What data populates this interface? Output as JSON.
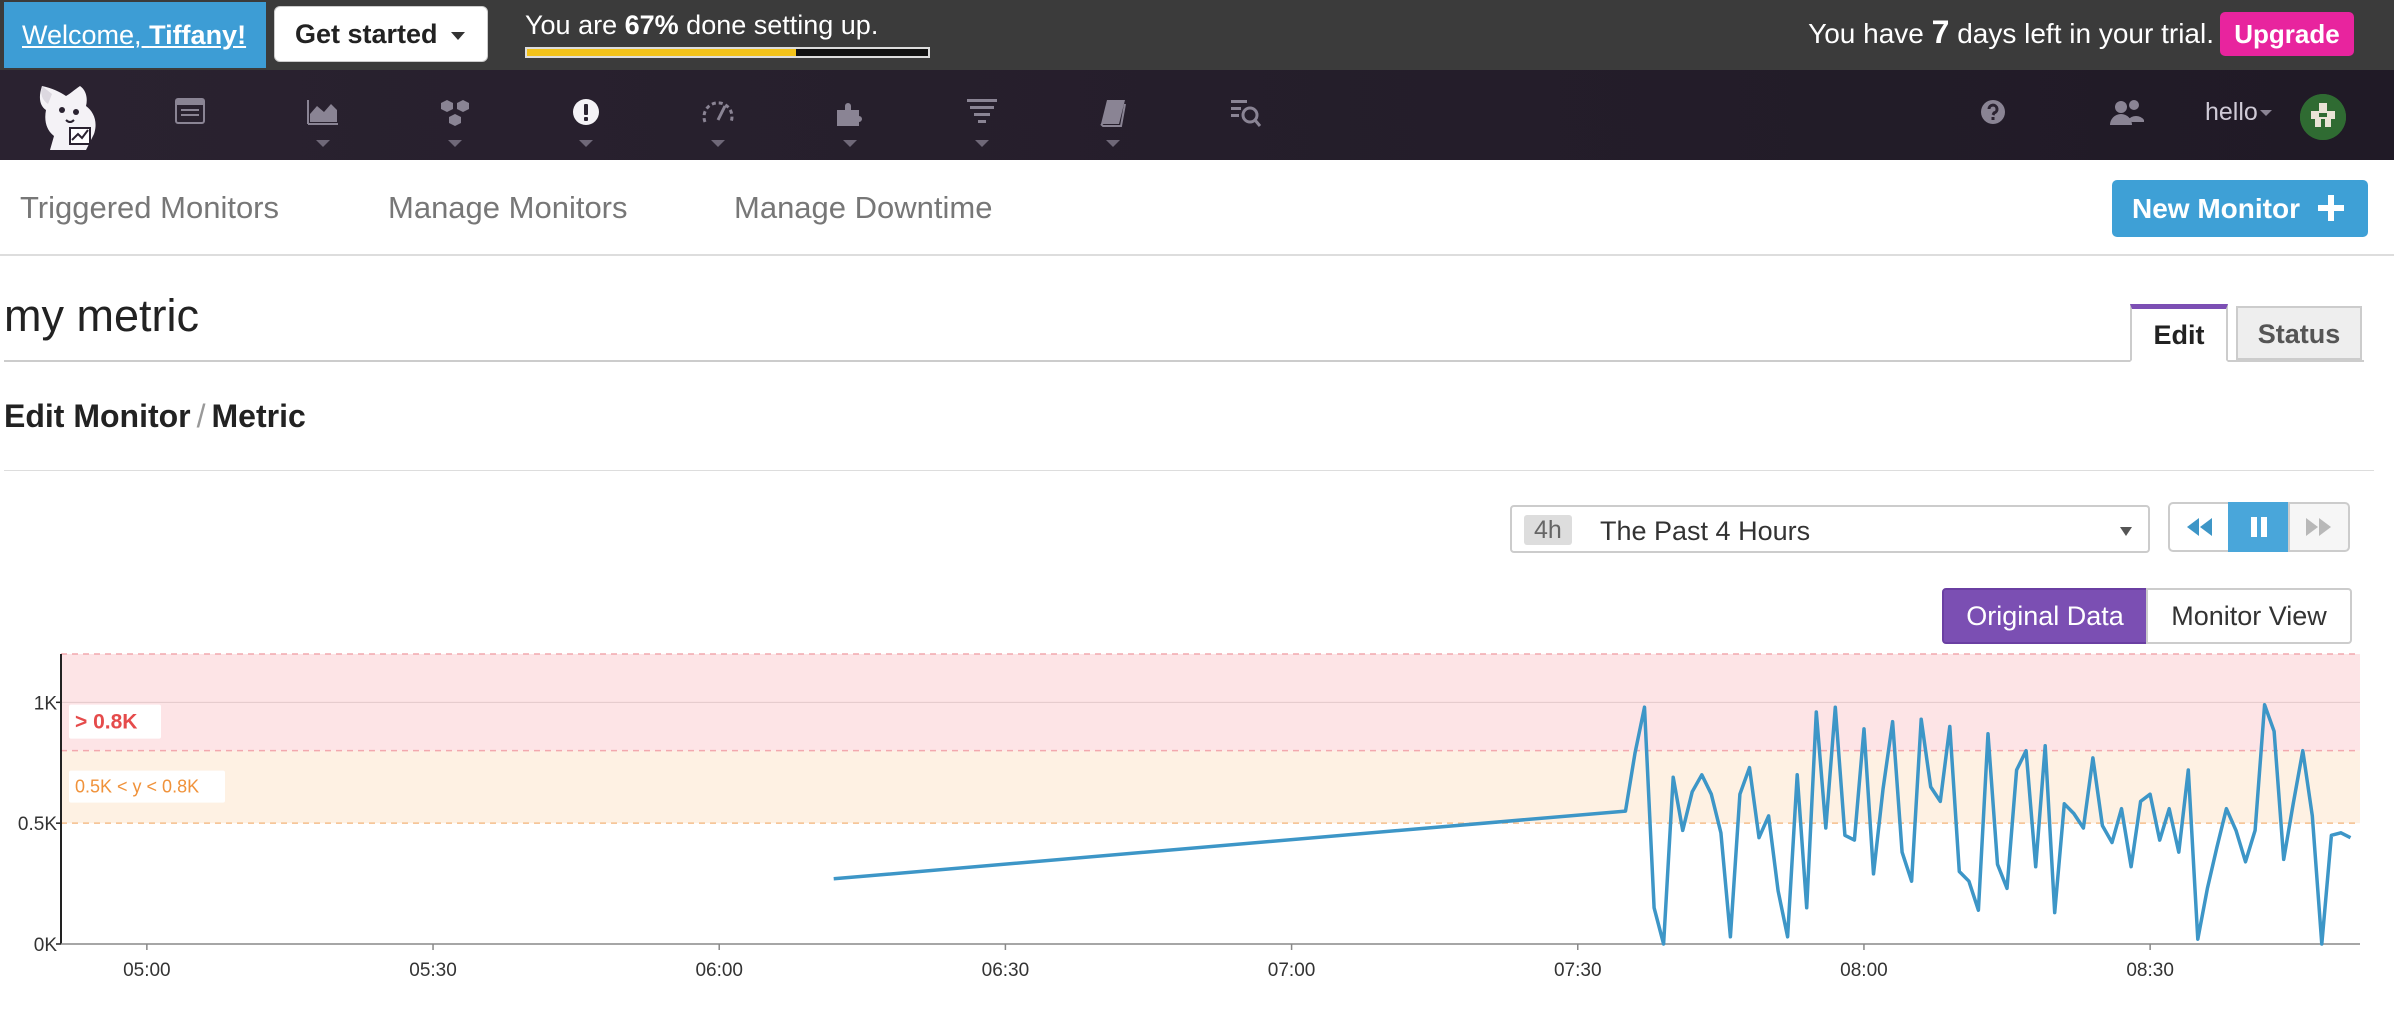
{
  "onboarding": {
    "welcome_prefix": "Welcome,",
    "welcome_name": "Tiffany!",
    "get_started_label": "Get started",
    "progress_prefix": "You are",
    "progress_percent": "67%",
    "progress_suffix": "done setting up.",
    "progress_fraction": 0.67,
    "trial_prefix": "You have",
    "trial_days": "7",
    "trial_suffix": "days left in your trial.",
    "upgrade_label": "Upgrade"
  },
  "nav": {
    "items": [
      {
        "icon": "dashboard-icon",
        "has_menu": false
      },
      {
        "icon": "area-chart-icon",
        "has_menu": true
      },
      {
        "icon": "infrastructure-hexagons-icon",
        "has_menu": true
      },
      {
        "icon": "monitors-alert-icon",
        "has_menu": true
      },
      {
        "icon": "apm-speedometer-icon",
        "has_menu": true
      },
      {
        "icon": "integrations-puzzle-icon",
        "has_menu": true
      },
      {
        "icon": "logs-filter-icon",
        "has_menu": true
      },
      {
        "icon": "notebooks-book-icon",
        "has_menu": true
      },
      {
        "icon": "watchdog-binoculars-icon",
        "has_menu": false
      }
    ],
    "help_icon": "question-circle-icon",
    "team_icon": "users-icon",
    "user_label": "hello"
  },
  "subnav": {
    "links": [
      "Triggered Monitors",
      "Manage Monitors",
      "Manage Downtime"
    ],
    "new_monitor_label": "New Monitor"
  },
  "monitor": {
    "title": "my metric",
    "tabs": [
      "Edit",
      "Status"
    ],
    "active_tab": "Edit",
    "breadcrumb": [
      "Edit Monitor",
      "Metric"
    ]
  },
  "timeframe": {
    "badge": "4h",
    "label": "The Past 4 Hours"
  },
  "view_toggle": {
    "options": [
      "Original Data",
      "Monitor View"
    ],
    "active": "Original Data"
  },
  "colors": {
    "series": "#3d96c7",
    "critical_band": "#fde4e6",
    "warning_band": "#fef1e3",
    "critical_text": "#e54b4b",
    "warning_text": "#f0923a"
  },
  "chart_data": {
    "type": "line",
    "xlabel": "",
    "ylabel": "",
    "x_ticks": [
      "05:00",
      "05:30",
      "06:00",
      "06:30",
      "07:00",
      "07:30",
      "08:00",
      "08:30"
    ],
    "y_ticks": [
      "0K",
      "0.5K",
      "1K"
    ],
    "ylim": [
      0,
      1200
    ],
    "xlim": [
      "04:51",
      "08:52"
    ],
    "thresholds": {
      "critical": {
        "label": "> 0.8K",
        "value": 800
      },
      "warning": {
        "label": "0.5K < y < 0.8K",
        "min": 500,
        "max": 800
      }
    },
    "series": [
      {
        "x": [
          "06:12",
          "07:35",
          "07:36",
          "07:37",
          "07:38",
          "07:39",
          "07:40",
          "07:41",
          "07:42",
          "07:43",
          "07:44",
          "07:45",
          "07:46",
          "07:47",
          "07:48",
          "07:49",
          "07:50",
          "07:51",
          "07:52",
          "07:53",
          "07:54",
          "07:55",
          "07:56",
          "07:57",
          "07:58",
          "07:59",
          "08:00",
          "08:01",
          "08:02",
          "08:03",
          "08:04",
          "08:05",
          "08:06",
          "08:07",
          "08:08",
          "08:09",
          "08:10",
          "08:11",
          "08:12",
          "08:13",
          "08:14",
          "08:15",
          "08:16",
          "08:17",
          "08:18",
          "08:19",
          "08:20",
          "08:21",
          "08:22",
          "08:23",
          "08:24",
          "08:25",
          "08:26",
          "08:27",
          "08:28",
          "08:29",
          "08:30",
          "08:31",
          "08:32",
          "08:33",
          "08:34",
          "08:35",
          "08:36",
          "08:37",
          "08:38",
          "08:39",
          "08:40",
          "08:41",
          "08:42",
          "08:43",
          "08:44",
          "08:45",
          "08:46",
          "08:47",
          "08:48",
          "08:49",
          "08:50",
          "08:51"
        ],
        "y": [
          270,
          550,
          790,
          980,
          150,
          0,
          690,
          470,
          630,
          700,
          620,
          460,
          30,
          620,
          730,
          440,
          530,
          220,
          30,
          700,
          150,
          960,
          480,
          980,
          450,
          430,
          890,
          290,
          640,
          920,
          380,
          260,
          930,
          650,
          590,
          900,
          300,
          260,
          140,
          870,
          330,
          230,
          720,
          800,
          320,
          820,
          130,
          580,
          540,
          480,
          770,
          490,
          420,
          560,
          320,
          590,
          620,
          430,
          560,
          380,
          720,
          20,
          230,
          400,
          560,
          470,
          340,
          470,
          990,
          880,
          350,
          580,
          800,
          530,
          0,
          450,
          460,
          440
        ]
      }
    ]
  }
}
